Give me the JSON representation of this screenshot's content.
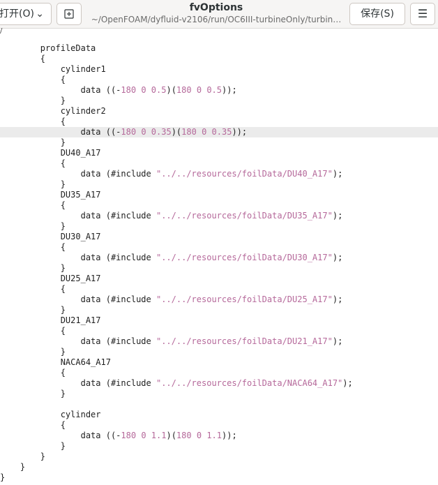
{
  "header": {
    "open_label": "打开(O)",
    "title": "fvOptions",
    "subtitle": "~/OpenFOAM/dyfluid-v2106/run/OC6III-turbineOnly/turbin…",
    "save_label": "保存(S)",
    "menu_glyph": "☰"
  },
  "editor": {
    "top_fragment": "/",
    "lines": {
      "l0": {
        "t": "        profileData"
      },
      "l1": {
        "t": "        {"
      },
      "l2": {
        "t": "            cylinder1"
      },
      "l3": {
        "t": "            {"
      },
      "l4": {
        "pre": "                data ((-",
        "n1": "180",
        "s1": " ",
        "n2": "0",
        "s2": " ",
        "n3": "0.5",
        "m": ")(",
        "n4": "180",
        "s3": " ",
        "n5": "0",
        "s4": " ",
        "n6": "0.5",
        "post": "));"
      },
      "l5": {
        "t": "            }"
      },
      "l6": {
        "t": "            cylinder2"
      },
      "l7": {
        "t": "            {"
      },
      "l8": {
        "pre": "                data ((-",
        "n1": "180",
        "s1": " ",
        "n2": "0",
        "s2": " ",
        "n3": "0.35",
        "m": ")(",
        "n4": "180",
        "s3": " ",
        "n5": "0",
        "s4": " ",
        "n6": "0.35",
        "post": "));"
      },
      "l9": {
        "t": "            }"
      },
      "l10": {
        "t": "            DU40_A17"
      },
      "l11": {
        "t": "            {"
      },
      "l12": {
        "pre": "                data (#include ",
        "str": "\"../../resources/foilData/DU40_A17\"",
        "post": ");"
      },
      "l13": {
        "t": "            }"
      },
      "l14": {
        "t": "            DU35_A17"
      },
      "l15": {
        "t": "            {"
      },
      "l16": {
        "pre": "                data (#include ",
        "str": "\"../../resources/foilData/DU35_A17\"",
        "post": ");"
      },
      "l17": {
        "t": "            }"
      },
      "l18": {
        "t": "            DU30_A17"
      },
      "l19": {
        "t": "            {"
      },
      "l20": {
        "pre": "                data (#include ",
        "str": "\"../../resources/foilData/DU30_A17\"",
        "post": ");"
      },
      "l21": {
        "t": "            }"
      },
      "l22": {
        "t": "            DU25_A17"
      },
      "l23": {
        "t": "            {"
      },
      "l24": {
        "pre": "                data (#include ",
        "str": "\"../../resources/foilData/DU25_A17\"",
        "post": ");"
      },
      "l25": {
        "t": "            }"
      },
      "l26": {
        "t": "            DU21_A17"
      },
      "l27": {
        "t": "            {"
      },
      "l28": {
        "pre": "                data (#include ",
        "str": "\"../../resources/foilData/DU21_A17\"",
        "post": ");"
      },
      "l29": {
        "t": "            }"
      },
      "l30": {
        "t": "            NACA64_A17"
      },
      "l31": {
        "t": "            {"
      },
      "l32": {
        "pre": "                data (#include ",
        "str": "\"../../resources/foilData/NACA64_A17\"",
        "post": ");"
      },
      "l33": {
        "t": "            }"
      },
      "l34": {
        "t": ""
      },
      "l35": {
        "t": "            cylinder"
      },
      "l36": {
        "t": "            {"
      },
      "l37": {
        "pre": "                data ((-",
        "n1": "180",
        "s1": " ",
        "n2": "0",
        "s2": " ",
        "n3": "1.1",
        "m": ")(",
        "n4": "180",
        "s3": " ",
        "n5": "0",
        "s4": " ",
        "n6": "1.1",
        "post": "));"
      },
      "l38": {
        "t": "            }"
      },
      "l39": {
        "t": "        }"
      },
      "l40": {
        "t": "    }"
      },
      "l41": {
        "t": "}"
      }
    }
  }
}
